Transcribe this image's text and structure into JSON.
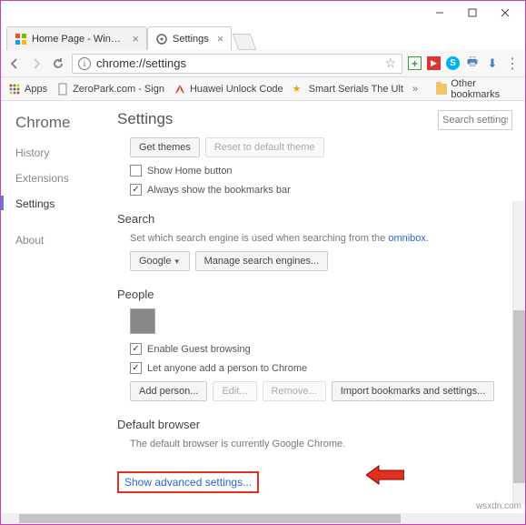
{
  "window": {
    "tabs": [
      {
        "label": "Home Page - Windows T",
        "favicon": "win"
      },
      {
        "label": "Settings",
        "favicon": "gear"
      }
    ],
    "url": "chrome://settings",
    "extensions": [
      "plus-green",
      "video-red",
      "skype-blue",
      "printer",
      "down-arrow"
    ]
  },
  "bookmarks": {
    "apps": "Apps",
    "items": [
      "ZeroPark.com - Sign",
      "Huawei Unlock Code",
      "Smart Serials The Ult"
    ],
    "other": "Other bookmarks"
  },
  "nav": {
    "brand": "Chrome",
    "items": [
      "History",
      "Extensions",
      "Settings",
      "About"
    ],
    "active": "Settings"
  },
  "settings": {
    "title": "Settings",
    "search_placeholder": "Search settings",
    "appearance": {
      "get_themes": "Get themes",
      "reset_theme": "Reset to default theme",
      "show_home": "Show Home button",
      "show_bm": "Always show the bookmarks bar"
    },
    "search": {
      "title": "Search",
      "desc_pre": "Set which search engine is used when searching from the ",
      "omni": "omnibox",
      "engine": "Google",
      "manage": "Manage search engines..."
    },
    "people": {
      "title": "People",
      "guest": "Enable Guest browsing",
      "anyone": "Let anyone add a person to Chrome",
      "add": "Add person...",
      "edit": "Edit...",
      "remove": "Remove...",
      "import": "Import bookmarks and settings..."
    },
    "default_browser": {
      "title": "Default browser",
      "desc": "The default browser is currently Google Chrome."
    },
    "advanced": "Show advanced settings..."
  },
  "watermark": "wsxdn.com"
}
